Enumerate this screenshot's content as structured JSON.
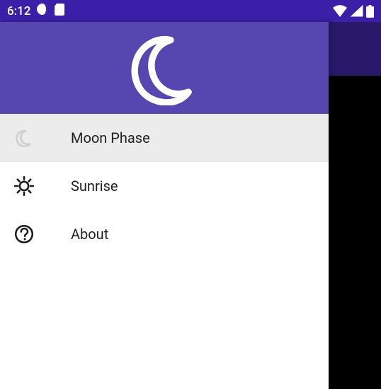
{
  "status": {
    "time": "6:12"
  },
  "nav": {
    "items": [
      {
        "label": "Moon Phase"
      },
      {
        "label": "Sunrise"
      },
      {
        "label": "About"
      }
    ]
  }
}
